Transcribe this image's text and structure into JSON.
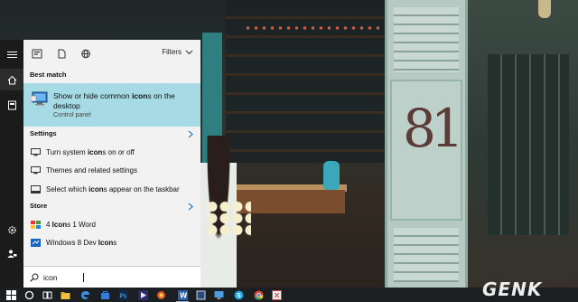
{
  "panel": {
    "filters_label": "Filters",
    "best_match": {
      "header": "Best match",
      "title_html_parts": [
        "Show or hide common ",
        "icon",
        "s on the desktop"
      ],
      "subtitle": "Control panel"
    },
    "settings": {
      "header": "Settings",
      "items": [
        {
          "parts": [
            "Turn system ",
            "icon",
            "s on or off"
          ],
          "icon": "display-settings-icon"
        },
        {
          "parts": [
            "Themes and related settings"
          ],
          "icon": "display-settings-icon"
        },
        {
          "parts": [
            "Select which ",
            "icon",
            "s appear on the taskbar"
          ],
          "icon": "taskbar-settings-icon"
        }
      ]
    },
    "store": {
      "header": "Store",
      "items": [
        {
          "parts": [
            "4 ",
            "Icon",
            "s 1 Word"
          ],
          "icon": "game-app-icon"
        },
        {
          "parts": [
            "Windows 8 Dev ",
            "Icon",
            "s"
          ],
          "icon": "store-app-icon"
        }
      ]
    }
  },
  "search": {
    "value": "icon"
  },
  "watermark": "GENK",
  "colors": {
    "highlight": "#a6dbe6",
    "panel_bg": "#f2f2f2",
    "rail_bg": "#1b1b1b",
    "taskbar_bg": "#1b1f22"
  }
}
